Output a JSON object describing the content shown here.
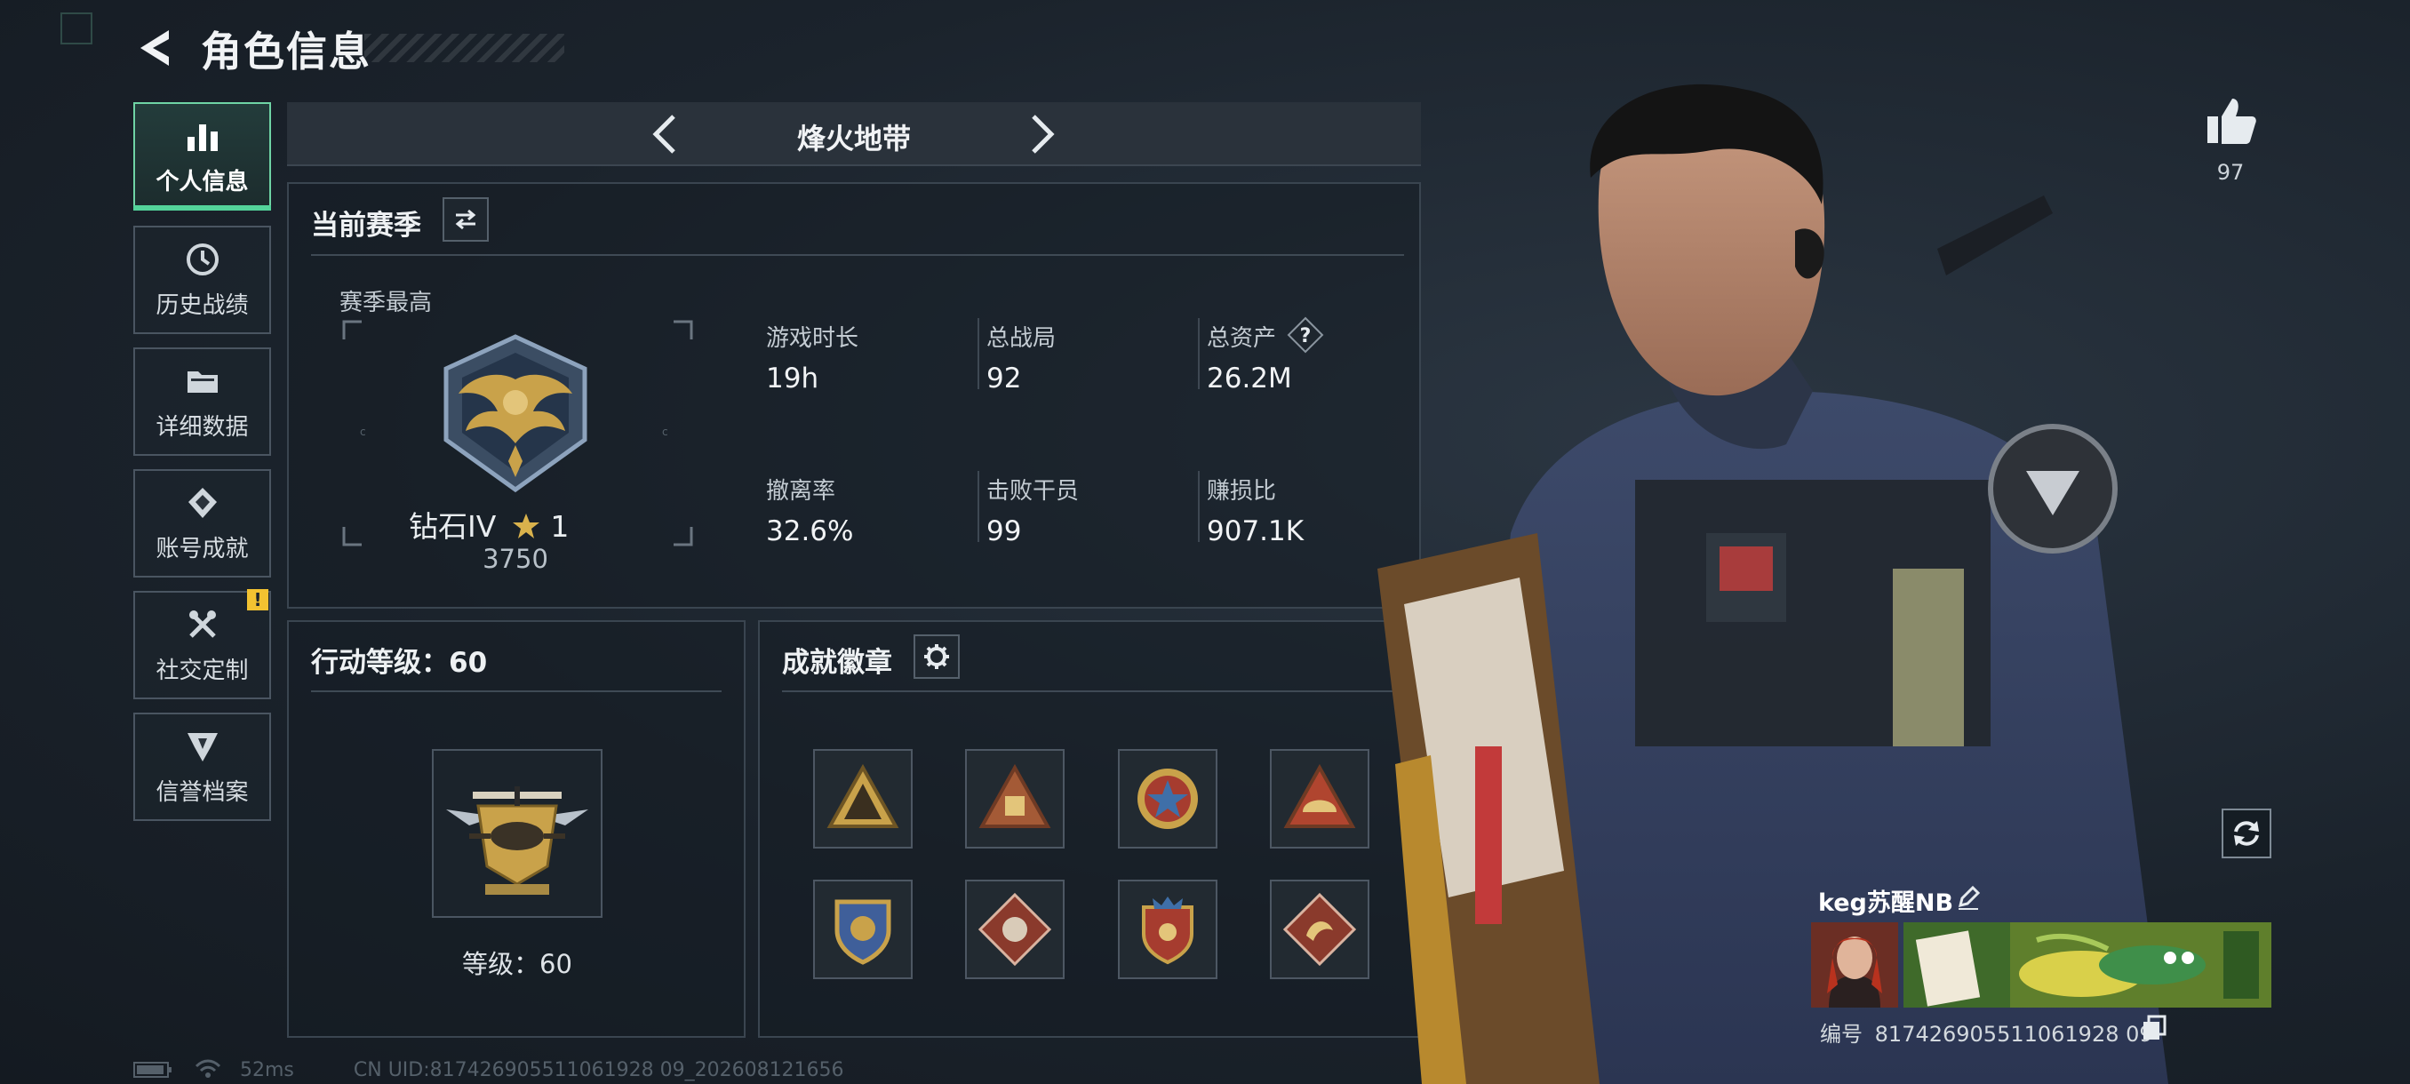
{
  "header": {
    "title": "角色信息"
  },
  "sidebar": {
    "items": [
      {
        "label": "个人信息",
        "icon": "bar-chart-icon",
        "active": true
      },
      {
        "label": "历史战绩",
        "icon": "history-icon"
      },
      {
        "label": "详细数据",
        "icon": "folder-icon"
      },
      {
        "label": "账号成就",
        "icon": "achievement-icon"
      },
      {
        "label": "社交定制",
        "icon": "tools-icon",
        "badge": "!"
      },
      {
        "label": "信誉档案",
        "icon": "shield-icon"
      }
    ]
  },
  "mode": {
    "title": "烽火地带"
  },
  "season": {
    "title": "当前赛季",
    "best_label": "赛季最高",
    "rank_name": "钻石IV",
    "rank_stars": "1",
    "rank_points": "3750",
    "stats": [
      {
        "label": "游戏时长",
        "value": "19h"
      },
      {
        "label": "总战局",
        "value": "92"
      },
      {
        "label": "总资产",
        "value": "26.2M",
        "help": "?"
      },
      {
        "label": "撤离率",
        "value": "32.6%"
      },
      {
        "label": "击败干员",
        "value": "99"
      },
      {
        "label": "赚损比",
        "value": "907.1K"
      }
    ]
  },
  "action_level": {
    "title": "行动等级：60",
    "level_text": "等级：60"
  },
  "achievements": {
    "title": "成就徽章",
    "badge_count": 8
  },
  "status_bar": {
    "ping": "52ms",
    "uid": "CN UID:817426905511061928 09_202608121656"
  },
  "player": {
    "likes": "97",
    "name": "keg苏醒NB",
    "id_label": "编号",
    "id_value": "817426905511061928 09"
  },
  "colors": {
    "accent_green": "#53d39a",
    "badge_gold": "#c9a24a",
    "alert_yellow": "#f2c231"
  }
}
